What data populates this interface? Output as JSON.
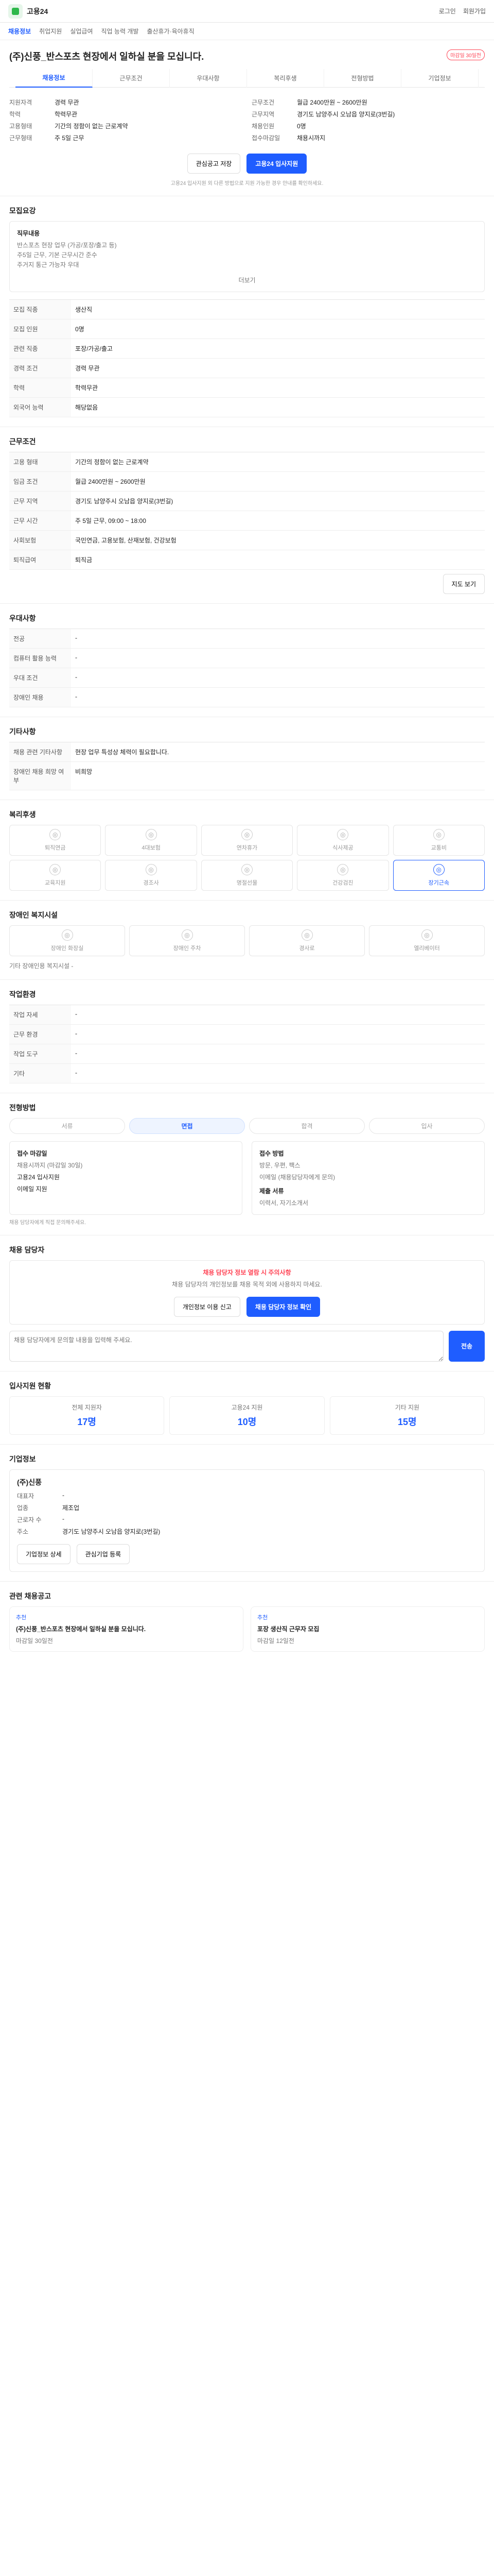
{
  "top": {
    "site": "고용24",
    "menu_items": [
      "로그인",
      "회원가입"
    ]
  },
  "subnav": {
    "items": [
      "채용정보",
      "취업지원",
      "실업급여",
      "직업 능력 개발",
      "출산휴가·육아휴직"
    ],
    "active_index": 0
  },
  "tabs": {
    "items": [
      "채용정보",
      "근무조건",
      "우대사항",
      "복리후생",
      "전형방법",
      "기업정보"
    ],
    "active_index": 0
  },
  "job": {
    "title": "(주)신풍_반스포츠 현장에서 일하실 분을 모십니다.",
    "badge": "마감일 30일전",
    "left": [
      {
        "k": "지원자격",
        "v": "경력 무관"
      },
      {
        "k": "학력",
        "v": "학력무관"
      },
      {
        "k": "고용형태",
        "v": "기간의 정함이 없는 근로계약"
      },
      {
        "k": "근무형태",
        "v": "주 5일 근무"
      }
    ],
    "right": [
      {
        "k": "근무조건",
        "v": "월급 2400만원 ~ 2600만원"
      },
      {
        "k": "근무지역",
        "v": "경기도 남양주시 오남읍 양지로(3번길)"
      },
      {
        "k": "채용인원",
        "v": "0명"
      },
      {
        "k": "접수마감일",
        "v": "채용시까지"
      }
    ],
    "buttons": {
      "save": "관심공고 저장",
      "apply": "고용24 입사지원"
    },
    "note": "고용24 입사지원 외 다른 방법으로 지원 가능한 경우 안내를 확인하세요."
  },
  "recruit": {
    "head": "모집요강",
    "box_title": "직무내용",
    "box_text": "반스포츠 현장 업무 (가공/포장/출고 등)\n주5일 근무, 기본 근무시간 준수\n주거지 통근 가능자 우대",
    "more": "더보기"
  },
  "basic_table": {
    "rows": [
      {
        "k": "모집 직종",
        "v": "생산직"
      },
      {
        "k": "모집 인원",
        "v": "0명"
      },
      {
        "k": "관련 직종",
        "v": "포장/가공/출고"
      },
      {
        "k": "경력 조건",
        "v": "경력 무관"
      },
      {
        "k": "학력",
        "v": "학력무관"
      },
      {
        "k": "외국어 능력",
        "v": "해당없음"
      }
    ]
  },
  "conditions": {
    "head": "근무조건",
    "rows": [
      {
        "k": "고용 형태",
        "v": "기간의 정함이 없는 근로계약"
      },
      {
        "k": "임금 조건",
        "v": "월급 2400만원 ~ 2600만원"
      },
      {
        "k": "근무 지역",
        "v": "경기도 남양주시 오남읍 양지로(3번길)"
      },
      {
        "k": "근무 시간",
        "v": "주 5일 근무, 09:00 ~ 18:00"
      },
      {
        "k": "사회보험",
        "v": "국민연금, 고용보험, 산재보험, 건강보험"
      },
      {
        "k": "퇴직급여",
        "v": "퇴직금"
      }
    ],
    "button": "지도 보기"
  },
  "preference": {
    "head": "우대사항",
    "rows": [
      {
        "k": "전공",
        "v": "-"
      },
      {
        "k": "컴퓨터 활용 능력",
        "v": "-"
      },
      {
        "k": "우대 조건",
        "v": "-"
      },
      {
        "k": "장애인 채용",
        "v": "-"
      }
    ]
  },
  "etc": {
    "head": "기타사항",
    "rows": [
      {
        "k": "채용 관련 기타사항",
        "v": "현장 업무 특성상 체력이 필요합니다."
      },
      {
        "k": "장애인 채용 희망 여부",
        "v": "비희망"
      }
    ]
  },
  "benefits": {
    "head": "복리후생",
    "tiles": [
      "퇴직연금",
      "4대보험",
      "연차휴가",
      "식사제공",
      "교통비",
      "교육지원",
      "경조사",
      "명절선물",
      "건강검진",
      "장기근속"
    ],
    "active_index": 9
  },
  "accessibility": {
    "head": "장애인 복지시설",
    "tiles": [
      "장애인 화장실",
      "장애인 주차",
      "경사로",
      "엘리베이터"
    ],
    "note": "기타 장애인용 복지시설 -"
  },
  "environment": {
    "head": "작업환경",
    "rows": [
      {
        "k": "작업 자세",
        "v": "-"
      },
      {
        "k": "근무 환경",
        "v": "-"
      },
      {
        "k": "작업 도구",
        "v": "-"
      },
      {
        "k": "기타",
        "v": "-"
      }
    ]
  },
  "process": {
    "head": "전형방법",
    "steps": [
      "서류",
      "면접",
      "합격",
      "입사"
    ],
    "active_index": 1,
    "left_title": "접수 마감일",
    "left_lines": [
      "채용시까지 (마감일 30일)",
      "고용24 입사지원",
      "이메일 지원"
    ],
    "right_title": "접수 방법",
    "right_lines": [
      "방문, 우편, 팩스",
      "이메일 (채용담당자에게 문의)"
    ],
    "doc_title": "제출 서류",
    "doc_text": "이력서, 자기소개서",
    "notice": "채용 담당자에게 직접 문의해주세요."
  },
  "contact": {
    "head": "채용 담당자",
    "notice_title": "채용 담당자 정보 열람 시 주의사항",
    "notice_text": "채용 담당자의 개인정보를 채용 목적 외에 사용하지 마세요.",
    "buttons": {
      "view": "채용 담당자 정보 확인",
      "report": "개인정보 이용 신고"
    },
    "inquiry_placeholder": "채용 담당자에게 문의할 내용을 입력해 주세요.",
    "send": "전송"
  },
  "stats": {
    "head": "입사지원 현황",
    "items": [
      {
        "label": "전체 지원자",
        "value": "17명"
      },
      {
        "label": "고용24 지원",
        "value": "10명"
      },
      {
        "label": "기타 지원",
        "value": "15명"
      }
    ]
  },
  "company": {
    "head": "기업정보",
    "name": "(주)신풍",
    "rows": [
      {
        "k": "대표자",
        "v": "-"
      },
      {
        "k": "업종",
        "v": "제조업"
      },
      {
        "k": "근로자 수",
        "v": "-"
      },
      {
        "k": "주소",
        "v": "경기도 남양주시 오남읍 양지로(3번길)"
      }
    ],
    "buttons": [
      "기업정보 상세",
      "관심기업 등록"
    ]
  },
  "recommend": {
    "head": "관련 채용공고",
    "cards": [
      {
        "tag": "추천",
        "title": "(주)신풍_반스포츠 현장에서 일하실 분을 모십니다.",
        "meta": "마감일 30일전"
      },
      {
        "tag": "추천",
        "title": "포장 생산직 근무자 모집",
        "meta": "마감일 12일전"
      }
    ]
  }
}
